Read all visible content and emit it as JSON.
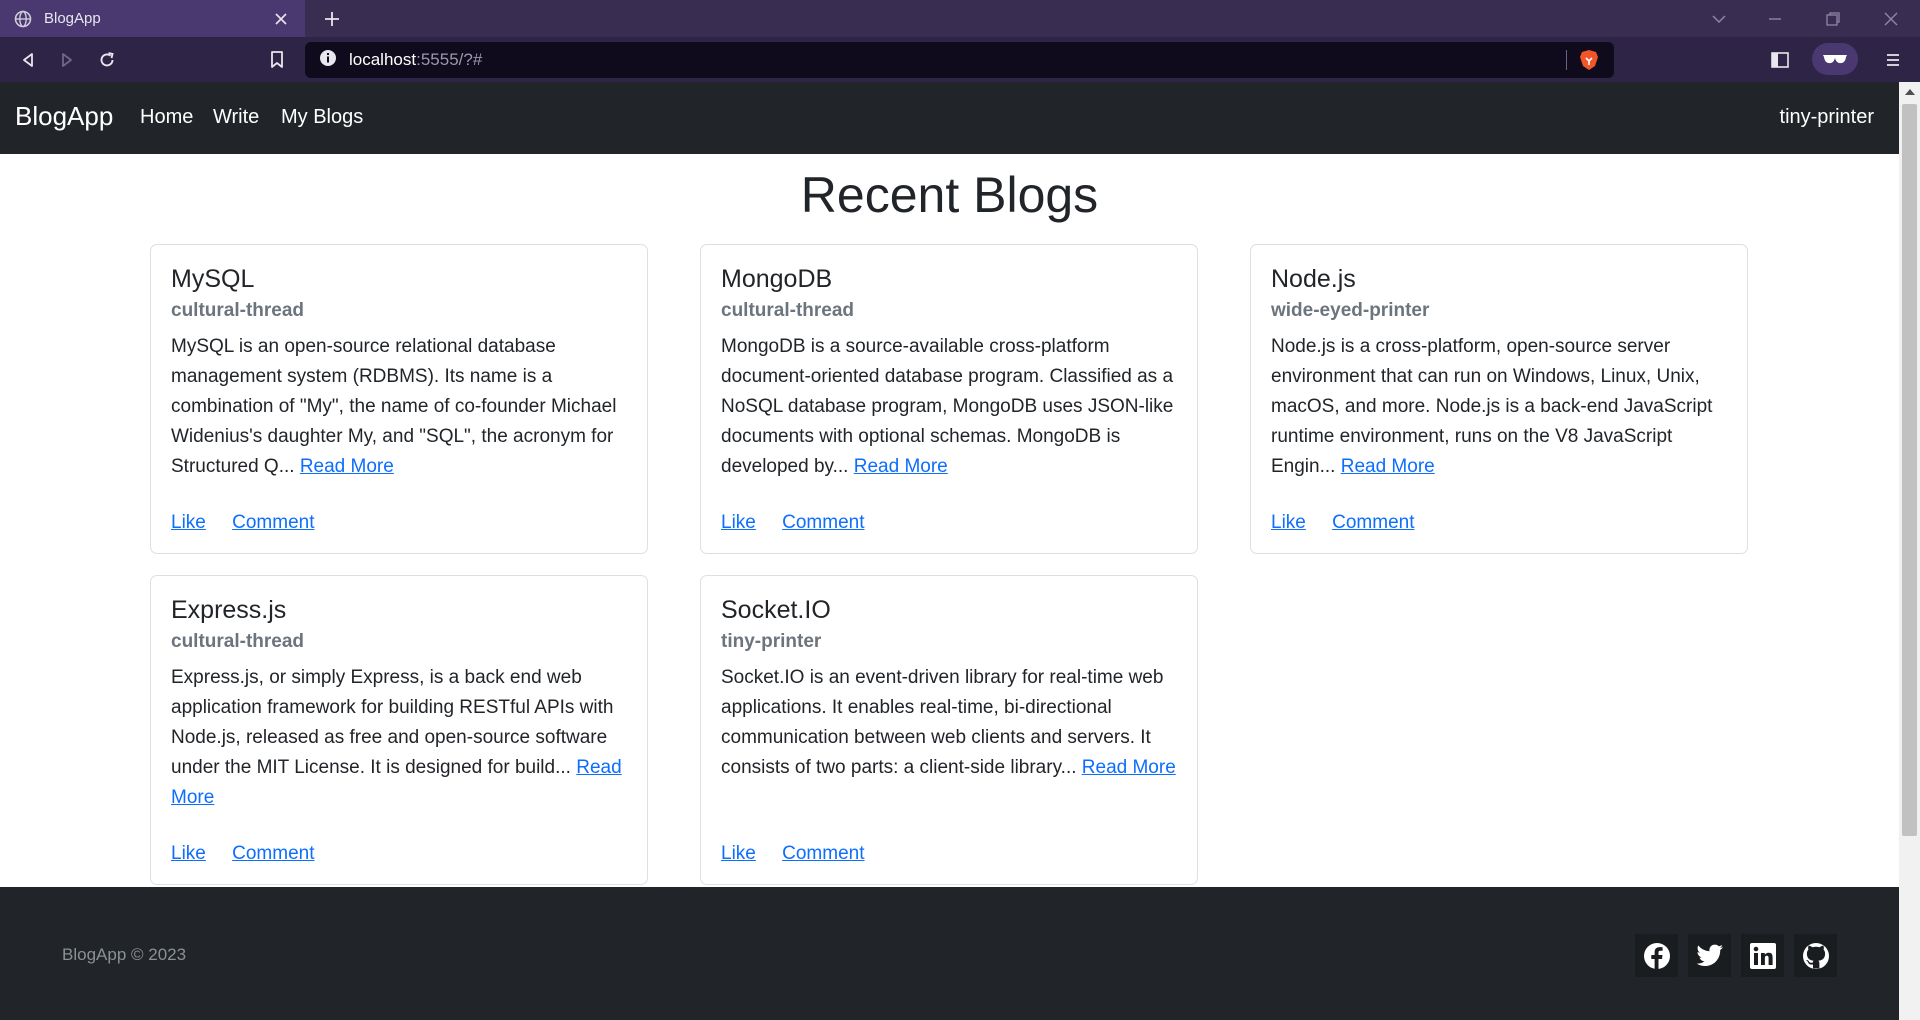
{
  "browser": {
    "tab_title": "BlogApp",
    "url_host": "localhost",
    "url_rest": ":5555/?#"
  },
  "navbar": {
    "brand": "BlogApp",
    "links": [
      "Home",
      "Write",
      "My Blogs"
    ],
    "user": "tiny-printer"
  },
  "main": {
    "title": "Recent Blogs",
    "read_more": "Read More",
    "like_label": "Like",
    "comment_label": "Comment",
    "blogs": [
      {
        "title": "MySQL",
        "author": "cultural-thread",
        "excerpt": "MySQL is an open-source relational database management system (RDBMS). Its name is a combination of \"My\", the name of co-founder Michael Widenius's daughter My, and \"SQL\", the acronym for Structured Q..."
      },
      {
        "title": "MongoDB",
        "author": "cultural-thread",
        "excerpt": "MongoDB is a source-available cross-platform document-oriented database program. Classified as a NoSQL database program, MongoDB uses JSON-like documents with optional schemas. MongoDB is developed by..."
      },
      {
        "title": "Node.js",
        "author": "wide-eyed-printer",
        "excerpt": "Node.js is a cross-platform, open-source server environment that can run on Windows, Linux, Unix, macOS, and more. Node.js is a back-end JavaScript runtime environment, runs on the V8 JavaScript Engin..."
      },
      {
        "title": "Express.js",
        "author": "cultural-thread",
        "excerpt": "Express.js, or simply Express, is a back end web application framework for building RESTful APIs with Node.js, released as free and open-source software under the MIT License. It is designed for build..."
      },
      {
        "title": "Socket.IO",
        "author": "tiny-printer",
        "excerpt": "Socket.IO is an event-driven library for real-time web applications. It enables real-time, bi-directional communication between web clients and servers. It consists of two parts: a client-side library..."
      }
    ]
  },
  "footer": {
    "copyright": "BlogApp © 2023",
    "social_icons": [
      "facebook-icon",
      "twitter-icon",
      "linkedin-icon",
      "github-icon"
    ]
  },
  "colors": {
    "navbar_bg": "#212529",
    "link": "#0d6efd",
    "author": "#6c757d",
    "browser_frame": "#3a2d52"
  }
}
